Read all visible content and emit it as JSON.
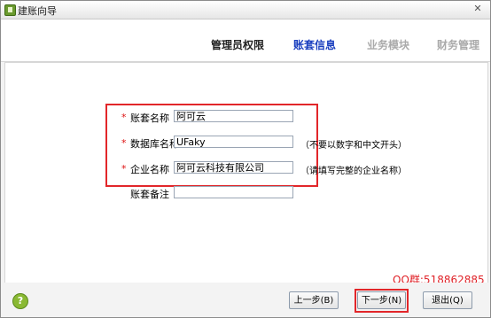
{
  "window": {
    "title": "建账向导",
    "close_glyph": "✕"
  },
  "steps": [
    {
      "label": "管理员权限",
      "state": "done"
    },
    {
      "label": "账套信息",
      "state": "active"
    },
    {
      "label": "业务模块",
      "state": "pending"
    },
    {
      "label": "财务管理",
      "state": "pending"
    }
  ],
  "form": {
    "required_mark": "*",
    "account_name": {
      "label": "账套名称",
      "value": "阿可云"
    },
    "db_name": {
      "label": "数据库名称",
      "value": "UFaky",
      "hint": "（不要以数字和中文开头）"
    },
    "company_name": {
      "label": "企业名称",
      "value": "阿可云科技有限公司",
      "hint": "（请填写完整的企业名称）"
    },
    "remark": {
      "label": "账套备注",
      "value": ""
    }
  },
  "footer": {
    "help_glyph": "?",
    "watermark": "QQ群:518862885",
    "prev_label": "上一步(B)",
    "next_label": "下一步(N)",
    "exit_label": "退出(Q)"
  },
  "colors": {
    "active_step": "#1a3fbf",
    "highlight": "#e2262a",
    "required": "#dd1111"
  },
  "icons": [
    "app-icon",
    "close-icon",
    "help-icon"
  ]
}
